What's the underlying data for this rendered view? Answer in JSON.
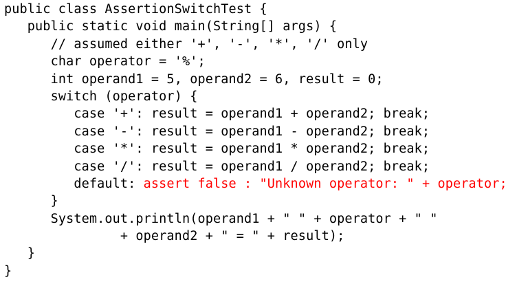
{
  "code": {
    "lines": [
      {
        "indent": "",
        "text": "public class AssertionSwitchTest {",
        "highlight": ""
      },
      {
        "indent": "   ",
        "text": "public static void main(String[] args) {",
        "highlight": ""
      },
      {
        "indent": "      ",
        "text": "// assumed either '+', '-', '*', '/' only",
        "highlight": ""
      },
      {
        "indent": "      ",
        "text": "char operator = '%';",
        "highlight": ""
      },
      {
        "indent": "      ",
        "text": "int operand1 = 5, operand2 = 6, result = 0;",
        "highlight": ""
      },
      {
        "indent": "      ",
        "text": "switch (operator) {",
        "highlight": ""
      },
      {
        "indent": "         ",
        "text": "case '+': result = operand1 + operand2; break;",
        "highlight": ""
      },
      {
        "indent": "         ",
        "text": "case '-': result = operand1 - operand2; break;",
        "highlight": ""
      },
      {
        "indent": "         ",
        "text": "case '*': result = operand1 * operand2; break;",
        "highlight": ""
      },
      {
        "indent": "         ",
        "text": "case '/': result = operand1 / operand2; break;",
        "highlight": ""
      },
      {
        "indent": "         ",
        "text": "default: ",
        "highlight": "assert false : \"Unknown operator: \" + operator;"
      },
      {
        "indent": "      ",
        "text": "}",
        "highlight": ""
      },
      {
        "indent": "      ",
        "text": "System.out.println(operand1 + \" \" + operator + \" \"",
        "highlight": ""
      },
      {
        "indent": "               ",
        "text": "+ operand2 + \" = \" + result);",
        "highlight": ""
      },
      {
        "indent": "   ",
        "text": "}",
        "highlight": ""
      },
      {
        "indent": "",
        "text": "}",
        "highlight": ""
      }
    ]
  },
  "colors": {
    "text": "#000000",
    "highlight": "#ff0000",
    "background": "#ffffff"
  }
}
